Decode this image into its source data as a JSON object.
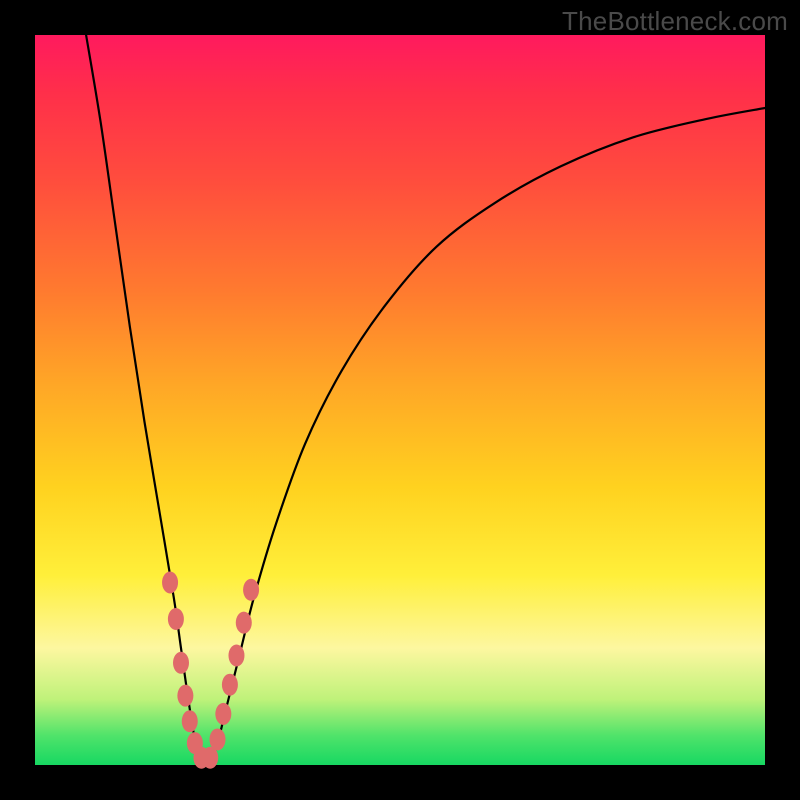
{
  "watermark": "TheBottleneck.com",
  "colors": {
    "frame": "#000000",
    "curve": "#000000",
    "dots": "#e06a6a",
    "gradient_stops": [
      "#ff1a5e",
      "#ff2f4a",
      "#ff4d3d",
      "#ff7a2f",
      "#ffa726",
      "#ffd21f",
      "#ffef3a",
      "#fdf7a0",
      "#bff27a",
      "#4fe36a",
      "#17d862"
    ]
  },
  "chart_data": {
    "type": "line",
    "title": "",
    "xlabel": "",
    "ylabel": "",
    "xlim": [
      0,
      100
    ],
    "ylim": [
      0,
      100
    ],
    "note": "Axes are unitless (0–100). y is the height of the curve above the bottom of the plot, estimated from the image. Curve dips to ~0 near x≈23 then rises asymptotically toward the right.",
    "series": [
      {
        "name": "bottleneck-curve",
        "x": [
          7,
          9,
          11,
          13,
          15,
          17,
          19,
          20,
          21,
          22,
          23,
          24,
          25,
          26,
          28,
          30,
          33,
          37,
          42,
          48,
          55,
          63,
          72,
          82,
          92,
          100
        ],
        "y": [
          100,
          88,
          74,
          60,
          47,
          35,
          23,
          16,
          9,
          3,
          0.5,
          0.7,
          3,
          7,
          15,
          23,
          33,
          44,
          54,
          63,
          71,
          77,
          82,
          86,
          88.5,
          90
        ]
      }
    ],
    "dots": {
      "name": "highlight-dots",
      "note": "Salmon dots clustered on both flanks of the valley, estimated positions.",
      "points": [
        {
          "x": 18.5,
          "y": 25
        },
        {
          "x": 19.3,
          "y": 20
        },
        {
          "x": 20.0,
          "y": 14
        },
        {
          "x": 20.6,
          "y": 9.5
        },
        {
          "x": 21.2,
          "y": 6
        },
        {
          "x": 21.9,
          "y": 3
        },
        {
          "x": 22.8,
          "y": 1
        },
        {
          "x": 24.0,
          "y": 1
        },
        {
          "x": 25.0,
          "y": 3.5
        },
        {
          "x": 25.8,
          "y": 7
        },
        {
          "x": 26.7,
          "y": 11
        },
        {
          "x": 27.6,
          "y": 15
        },
        {
          "x": 28.6,
          "y": 19.5
        },
        {
          "x": 29.6,
          "y": 24
        }
      ]
    }
  }
}
